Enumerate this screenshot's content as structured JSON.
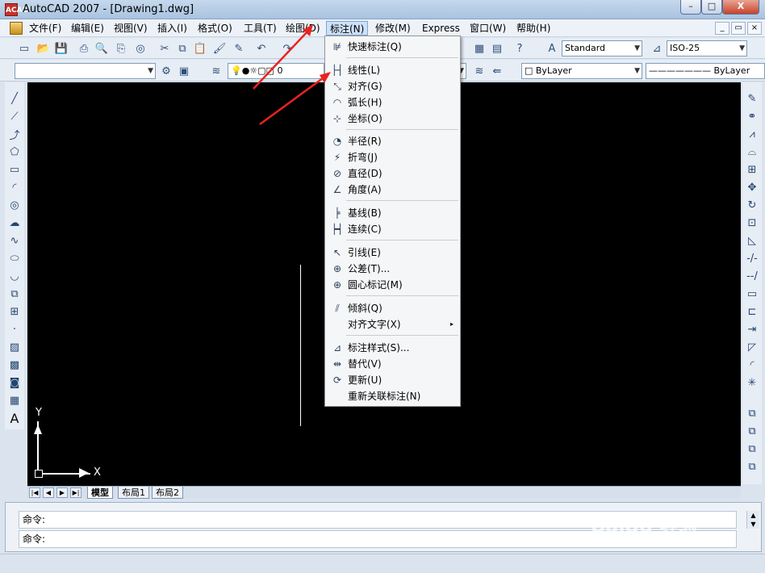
{
  "app": {
    "icon_text": "ACAD",
    "title": "AutoCAD 2007 - [Drawing1.dwg]"
  },
  "window_buttons": {
    "minimize": "–",
    "maximize": "□",
    "close": "X"
  },
  "mdi_buttons": {
    "minimize": "_",
    "restore": "▭",
    "close": "×"
  },
  "menubar": {
    "items": [
      "文件(F)",
      "编辑(E)",
      "视图(V)",
      "插入(I)",
      "格式(O)",
      "工具(T)",
      "绘图(D)",
      "标注(N)",
      "修改(M)",
      "Express",
      "窗口(W)",
      "帮助(H)"
    ],
    "active_item": "标注(N)"
  },
  "toolbar": {
    "text_style": "Standard",
    "dim_style": "ISO-25",
    "layer_name": "0",
    "color_combo": "ByLayer",
    "linetype_combo": "ByLayer"
  },
  "dimension_menu": {
    "groups": [
      [
        {
          "label": "快速标注(Q)",
          "icon": "quick-dimension-icon"
        }
      ],
      [
        {
          "label": "线性(L)",
          "icon": "linear-icon"
        },
        {
          "label": "对齐(G)",
          "icon": "aligned-icon"
        },
        {
          "label": "弧长(H)",
          "icon": "arc-length-icon"
        },
        {
          "label": "坐标(O)",
          "icon": "ordinate-icon"
        }
      ],
      [
        {
          "label": "半径(R)",
          "icon": "radius-icon"
        },
        {
          "label": "折弯(J)",
          "icon": "jogged-icon"
        },
        {
          "label": "直径(D)",
          "icon": "diameter-icon"
        },
        {
          "label": "角度(A)",
          "icon": "angular-icon"
        }
      ],
      [
        {
          "label": "基线(B)",
          "icon": "baseline-icon"
        },
        {
          "label": "连续(C)",
          "icon": "continue-icon"
        }
      ],
      [
        {
          "label": "引线(E)",
          "icon": "leader-icon"
        },
        {
          "label": "公差(T)...",
          "icon": "tolerance-icon"
        },
        {
          "label": "圆心标记(M)",
          "icon": "center-mark-icon"
        }
      ],
      [
        {
          "label": "倾斜(Q)",
          "icon": "oblique-icon"
        },
        {
          "label": "对齐文字(X)",
          "icon": "",
          "submenu": "▸"
        }
      ],
      [
        {
          "label": "标注样式(S)...",
          "icon": "dimension-style-icon"
        },
        {
          "label": "替代(V)",
          "icon": "override-icon"
        },
        {
          "label": "更新(U)",
          "icon": "update-icon"
        },
        {
          "label": "重新关联标注(N)",
          "icon": ""
        }
      ]
    ]
  },
  "canvas": {
    "ucs_x_label": "X",
    "ucs_y_label": "Y"
  },
  "layout_tabs": {
    "nav": [
      "|◀",
      "◀",
      "▶",
      "▶|"
    ],
    "tabs": [
      "模型",
      "布局1",
      "布局2"
    ],
    "active": "模型"
  },
  "command": {
    "prompt1": "命令:",
    "prompt2": "命令:",
    "scroll_up": "▲",
    "scroll_down": "▼"
  },
  "watermark": {
    "brand": "Baidu 经验",
    "url": "jingyan.baidu.com"
  },
  "colors": {
    "canvas": "#000000",
    "annotation_arrow": "#e8231f",
    "menu_highlight": "#cde1f7"
  }
}
